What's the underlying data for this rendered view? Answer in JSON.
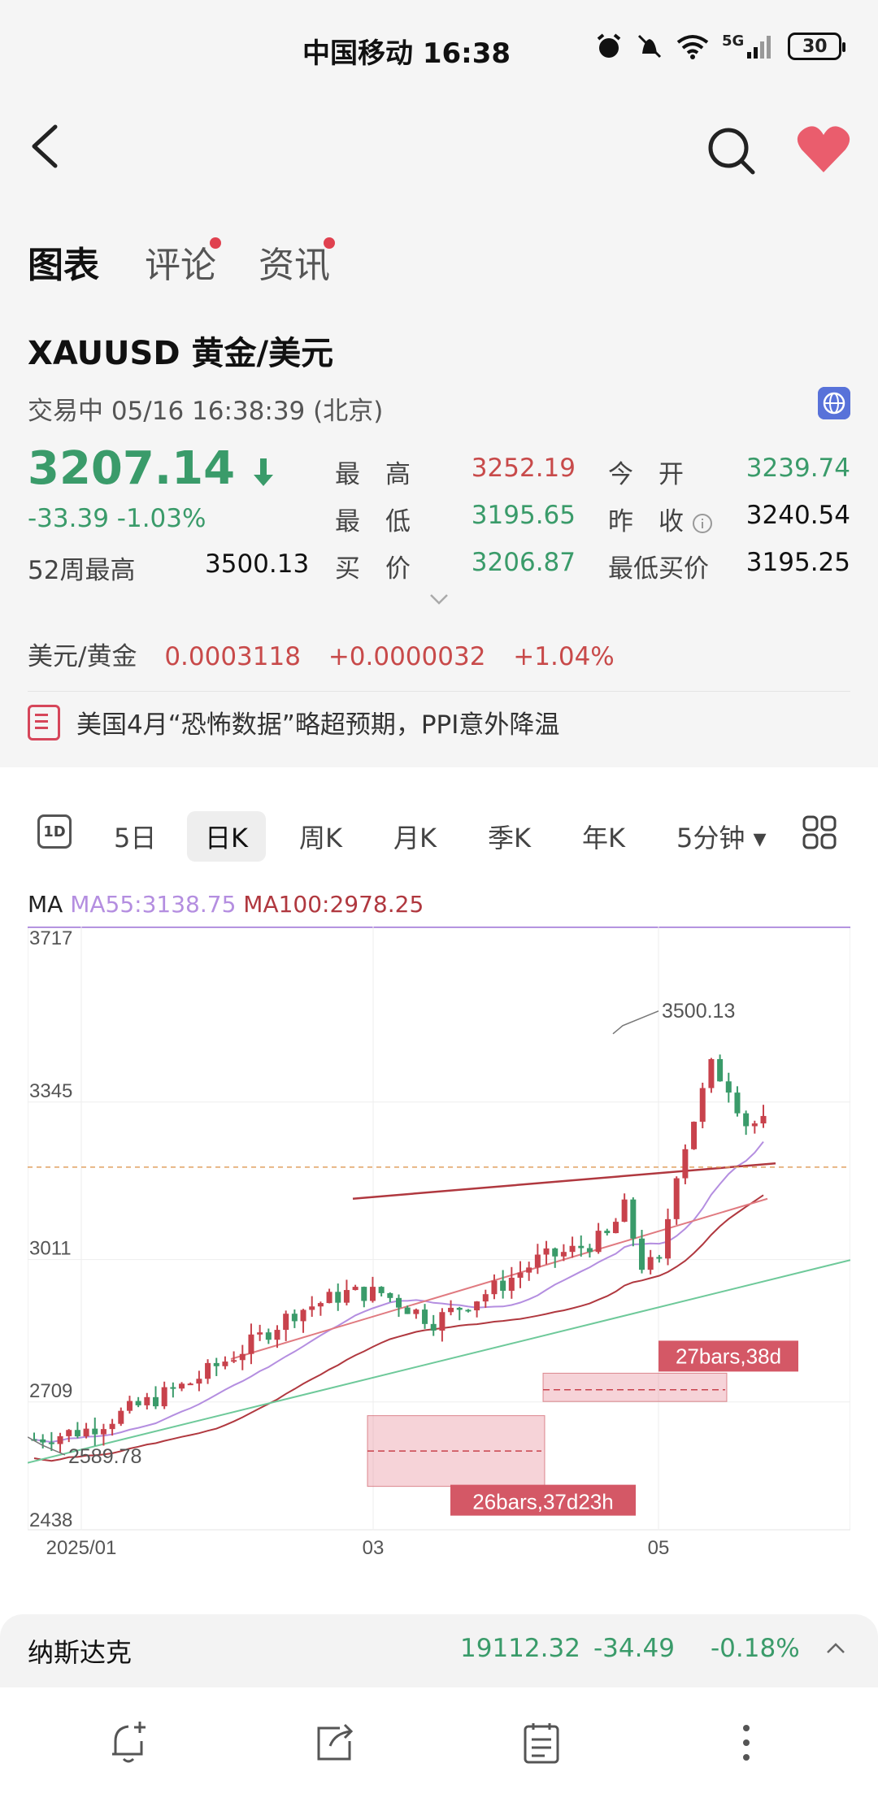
{
  "statusbar": {
    "carrier_time": "中国移动 16:38",
    "network": "5G",
    "battery": "30"
  },
  "tabs": [
    {
      "label": "图表",
      "active": true,
      "dot": false
    },
    {
      "label": "评论",
      "active": false,
      "dot": true
    },
    {
      "label": "资讯",
      "active": false,
      "dot": true
    }
  ],
  "quote": {
    "symbol": "XAUUSD  黄金/美元",
    "status_text": "交易中  05/16 16:38:39 (北京)",
    "price": "3207.14",
    "change": "-33.39  -1.03%",
    "w52_label": "52周最高",
    "w52_value": "3500.13",
    "high_label": "最　高",
    "high_value": "3252.19",
    "low_label": "最　低",
    "low_value": "3195.65",
    "bid_label": "买　价",
    "bid_value": "3206.87",
    "open_label": "今　开",
    "open_value": "3239.74",
    "prev_label": "昨　收",
    "prev_value": "3240.54",
    "minbid_label": "最低买价",
    "minbid_value": "3195.25",
    "fx_label": "美元/黄金",
    "fx_value": "0.0003118",
    "fx_change": "+0.0000032",
    "fx_pct": "+1.04%",
    "news": "美国4月“恐怖数据”略超预期，PPI意外降温"
  },
  "periods": [
    {
      "label": "5日"
    },
    {
      "label": "日K",
      "selected": true
    },
    {
      "label": "周K"
    },
    {
      "label": "月K"
    },
    {
      "label": "季K"
    },
    {
      "label": "年K"
    },
    {
      "label": "5分钟 ▾"
    }
  ],
  "period_icon": "1D",
  "ma_legend": {
    "ma": "MA",
    "ma55": "MA55:3138.75",
    "ma100": "MA100:2978.25"
  },
  "chart_data": {
    "type": "candlestick",
    "y_ticks": [
      "3717",
      "3345",
      "3011",
      "2709",
      "2438"
    ],
    "x_ticks": [
      "2025/01",
      "03",
      "05"
    ],
    "ylim": [
      2438,
      3717
    ],
    "annotations": {
      "high": "3500.13",
      "low": "2589.78",
      "box1": "26bars,37d23h",
      "box2": "27bars,38d"
    },
    "colors": {
      "up": "#c8424c",
      "down": "#3a9b6a",
      "ma55": "#b48ee0",
      "ma100": "#b0383f",
      "trend": "#6ec99a"
    }
  },
  "ticker": {
    "name": "纳斯达克",
    "value": "19112.32",
    "change": "-34.49",
    "pct": "-0.18%"
  },
  "nav": [
    "bell-plus-icon",
    "share-icon",
    "notes-icon",
    "more-icon"
  ]
}
